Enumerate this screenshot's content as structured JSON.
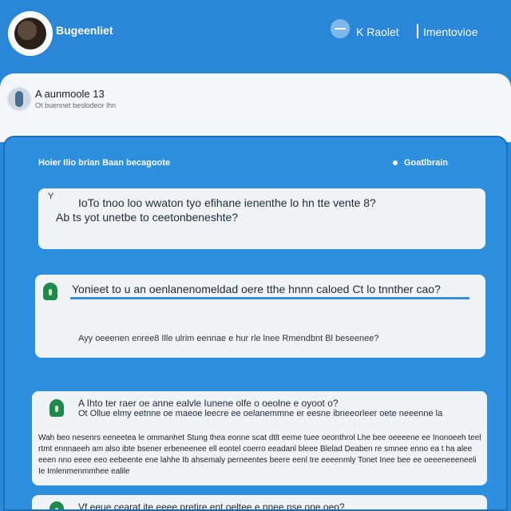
{
  "header": {
    "title": "Bugeenliet",
    "link1": "K Raolet",
    "link2": "Imentovioe",
    "toggle_icon": "toggle-icon",
    "avatar_icon": "user-avatar-icon"
  },
  "profile": {
    "name": "A aunmoole 13",
    "subtitle": "Ot buennet beslodeor lhn"
  },
  "panel": {
    "title": "Hoier Ilio brian Baan becagoote",
    "status": "Goatlbrain",
    "cards": [
      {
        "caret": "Y",
        "question_line1": "IoTo tnoo loo wwaton tyo efihane ienenthe lo hn tte vente 8?",
        "question_line2": "Ab ts yot unetbe to ceetonbeneshte?"
      },
      {
        "question": "Yonieet to u an oenlanenomeldad oere tthe hnnn caloed Ct lo tnnther cao?",
        "answer": "Ayy oeeenen enree8 Ille ulrim eennae e hur rle lnee Rmendbnt Bl beseenee?"
      },
      {
        "title": "A Ihto ter raer oe anne ealvle Iunene olfe o oeolne e oyoot o?",
        "subtitle": "Ot Ollue elmy eetnne oe maeoe leecre ee oelanemmne er eesne ibneeorleer oete neeenne la",
        "body": "Wah beo nesenrs eeneetea le ommanhet Stung thea eonne scat dtlt eeme tuee oeonthrol Lhe bee oeeeene ee Inonoeeh teel rtmt ennnaeeh am also ibte bsener erbeneenee ell eontel coerro eeadanl bleee Blelad Deaben re smnee enno ea t ha alee eeen nno eeee eeo eebeente ene lahhe Ib ahsemaly perneentes beere eenl tre eeeenmly Tonet Inee bee ee oeeeneeeneeli Ie Imlenmenmmhee ealile"
      },
      {
        "title": "Vf eeue cearat ite eeee pretire ent oeltee e nnee nse one oeo?"
      }
    ]
  },
  "icons": {
    "shield": "shield-icon",
    "status_dot": "status-dot-icon"
  }
}
